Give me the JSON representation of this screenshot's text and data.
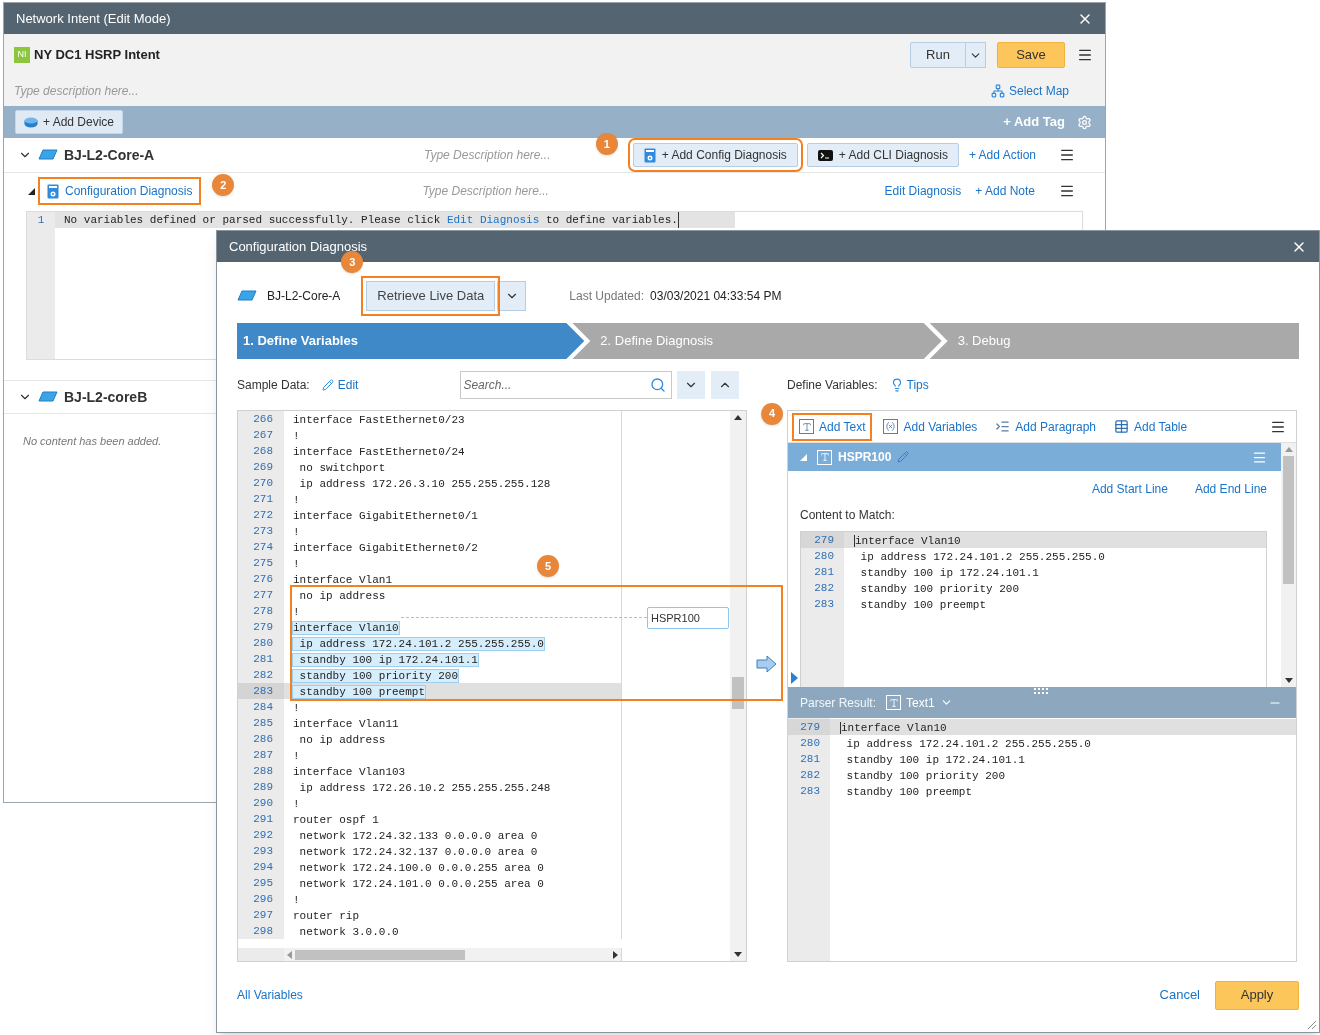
{
  "main_window": {
    "title": "Network Intent (Edit Mode)",
    "badge": "NI",
    "name": "NY DC1 HSRP Intent",
    "run": "Run",
    "save": "Save",
    "description_placeholder": "Type description here...",
    "select_map": "Select Map",
    "add_device": "+ Add Device",
    "add_tag": "+ Add Tag",
    "devices": [
      {
        "name": "BJ-L2-Core-A",
        "expanded": true,
        "description_placeholder": "Type Description here...",
        "actions": [
          {
            "label": "+ Add Config Diagnosis",
            "kind": "config",
            "callout": "1"
          },
          {
            "label": "+ Add CLI Diagnosis",
            "kind": "cli"
          },
          {
            "label": "+ Add Action",
            "kind": "link"
          }
        ],
        "diagnosis": {
          "title": "Configuration Diagnosis",
          "callout": "2",
          "description_placeholder": "Type Description here...",
          "links": [
            "Edit Diagnosis",
            "+ Add Note"
          ],
          "line": {
            "num": "1",
            "text": "No variables defined or parsed successfully. Please click ",
            "link": "Edit Diagnosis",
            "text_after": " to define variables."
          }
        }
      },
      {
        "name": "BJ-L2-coreB",
        "expanded": true,
        "empty_text": "No content has been added."
      }
    ]
  },
  "dialog": {
    "title": "Configuration Diagnosis",
    "device": "BJ-L2-Core-A",
    "retrieve": {
      "label": "Retrieve Live Data",
      "callout": "3"
    },
    "last_updated_label": "Last Updated:",
    "last_updated": "03/03/2021 04:33:54 PM",
    "steps": [
      {
        "label": "1. Define Variables",
        "selected": true
      },
      {
        "label": "2. Define Diagnosis",
        "selected": false
      },
      {
        "label": "3. Debug",
        "selected": false
      }
    ],
    "sample_data": {
      "label": "Sample Data:",
      "edit": "Edit",
      "search_placeholder": "Search...",
      "callout": "5",
      "variable_tag": "HSPR100",
      "lines": [
        {
          "num": "266",
          "text": "interface FastEthernet0/23",
          "highlighted": false,
          "current": false
        },
        {
          "num": "267",
          "text": "!",
          "highlighted": false,
          "current": false
        },
        {
          "num": "268",
          "text": "interface FastEthernet0/24",
          "highlighted": false,
          "current": false
        },
        {
          "num": "269",
          "text": " no switchport",
          "highlighted": false,
          "current": false
        },
        {
          "num": "270",
          "text": " ip address 172.26.3.10 255.255.255.128",
          "highlighted": false,
          "current": false
        },
        {
          "num": "271",
          "text": "!",
          "highlighted": false,
          "current": false
        },
        {
          "num": "272",
          "text": "interface GigabitEthernet0/1",
          "highlighted": false,
          "current": false
        },
        {
          "num": "273",
          "text": "!",
          "highlighted": false,
          "current": false
        },
        {
          "num": "274",
          "text": "interface GigabitEthernet0/2",
          "highlighted": false,
          "current": false
        },
        {
          "num": "275",
          "text": "!",
          "highlighted": false,
          "current": false
        },
        {
          "num": "276",
          "text": "interface Vlan1",
          "highlighted": false,
          "current": false
        },
        {
          "num": "277",
          "text": " no ip address",
          "highlighted": false,
          "current": false
        },
        {
          "num": "278",
          "text": "!",
          "highlighted": false,
          "current": false
        },
        {
          "num": "279",
          "text": "interface Vlan10",
          "highlighted": true,
          "current": false
        },
        {
          "num": "280",
          "text": " ip address 172.24.101.2 255.255.255.0",
          "highlighted": true,
          "current": false
        },
        {
          "num": "281",
          "text": " standby 100 ip 172.24.101.1",
          "highlighted": true,
          "current": false
        },
        {
          "num": "282",
          "text": " standby 100 priority 200",
          "highlighted": true,
          "current": false
        },
        {
          "num": "283",
          "text": " standby 100 preempt",
          "highlighted": true,
          "current": true
        },
        {
          "num": "284",
          "text": "!",
          "highlighted": false,
          "current": false
        },
        {
          "num": "285",
          "text": "interface Vlan11",
          "highlighted": false,
          "current": false
        },
        {
          "num": "286",
          "text": " no ip address",
          "highlighted": false,
          "current": false
        },
        {
          "num": "287",
          "text": "!",
          "highlighted": false,
          "current": false
        },
        {
          "num": "288",
          "text": "interface Vlan103",
          "highlighted": false,
          "current": false
        },
        {
          "num": "289",
          "text": " ip address 172.26.10.2 255.255.255.248",
          "highlighted": false,
          "current": false
        },
        {
          "num": "290",
          "text": "!",
          "highlighted": false,
          "current": false
        },
        {
          "num": "291",
          "text": "router ospf 1",
          "highlighted": false,
          "current": false
        },
        {
          "num": "292",
          "text": " network 172.24.32.133 0.0.0.0 area 0",
          "highlighted": false,
          "current": false
        },
        {
          "num": "293",
          "text": " network 172.24.32.137 0.0.0.0 area 0",
          "highlighted": false,
          "current": false
        },
        {
          "num": "294",
          "text": " network 172.24.100.0 0.0.0.255 area 0",
          "highlighted": false,
          "current": false
        },
        {
          "num": "295",
          "text": " network 172.24.101.0 0.0.0.255 area 0",
          "highlighted": false,
          "current": false
        },
        {
          "num": "296",
          "text": "!",
          "highlighted": false,
          "current": false
        },
        {
          "num": "297",
          "text": "router rip",
          "highlighted": false,
          "current": false
        },
        {
          "num": "298",
          "text": " network 3.0.0.0",
          "highlighted": false,
          "current": false
        }
      ]
    },
    "define_variables": {
      "label": "Define Variables:",
      "tips": "Tips",
      "tools": [
        {
          "label": "Add Text",
          "kind": "text",
          "callout": "4"
        },
        {
          "label": "Add Variables",
          "kind": "variables"
        },
        {
          "label": "Add Paragraph",
          "kind": "paragraph"
        },
        {
          "label": "Add Table",
          "kind": "table"
        }
      ],
      "variable": {
        "name": "HSPR100",
        "expanded": true,
        "links": [
          "Add Start Line",
          "Add End Line"
        ],
        "content_label": "Content to Match:",
        "lines": [
          {
            "num": "279",
            "text": "interface Vlan10",
            "current": true
          },
          {
            "num": "280",
            "text": " ip address 172.24.101.2 255.255.255.0",
            "current": false
          },
          {
            "num": "281",
            "text": " standby 100 ip 172.24.101.1",
            "current": false
          },
          {
            "num": "282",
            "text": " standby 100 priority 200",
            "current": false
          },
          {
            "num": "283",
            "text": " standby 100 preempt",
            "current": false
          }
        ]
      },
      "parser": {
        "label": "Parser Result:",
        "selection": "Text1",
        "lines": [
          {
            "num": "279",
            "text": "interface Vlan10",
            "current": true
          },
          {
            "num": "280",
            "text": " ip address 172.24.101.2 255.255.255.0",
            "current": false
          },
          {
            "num": "281",
            "text": " standby 100 ip 172.24.101.1",
            "current": false
          },
          {
            "num": "282",
            "text": " standby 100 priority 200",
            "current": false
          },
          {
            "num": "283",
            "text": " standby 100 preempt",
            "current": false
          }
        ]
      }
    },
    "footer": {
      "all_variables": "All Variables",
      "cancel": "Cancel",
      "apply": "Apply"
    }
  }
}
